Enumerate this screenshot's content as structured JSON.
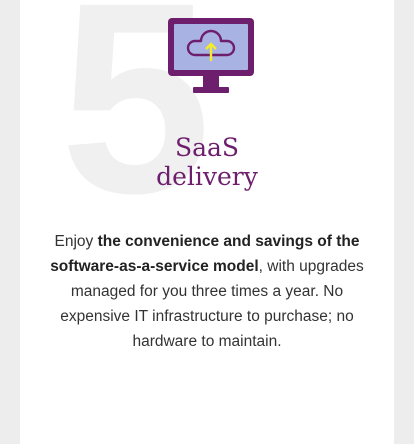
{
  "background_number": "5",
  "icon": "monitor-cloud-upload-icon",
  "colors": {
    "brand_purple": "#6d1f6d",
    "screen_fill": "#a9b3e3",
    "arrow_yellow": "#f4ec2b",
    "background_number": "#f0f0f0"
  },
  "title": {
    "line1": "SaaS",
    "line2": "delivery"
  },
  "description": {
    "prefix": "Enjoy ",
    "emphasis": "the convenience and savings of the software-as-a-service model",
    "suffix": ", with upgrades managed for you three times a year. No expensive IT infrastructure to purchase; no hardware to maintain."
  }
}
